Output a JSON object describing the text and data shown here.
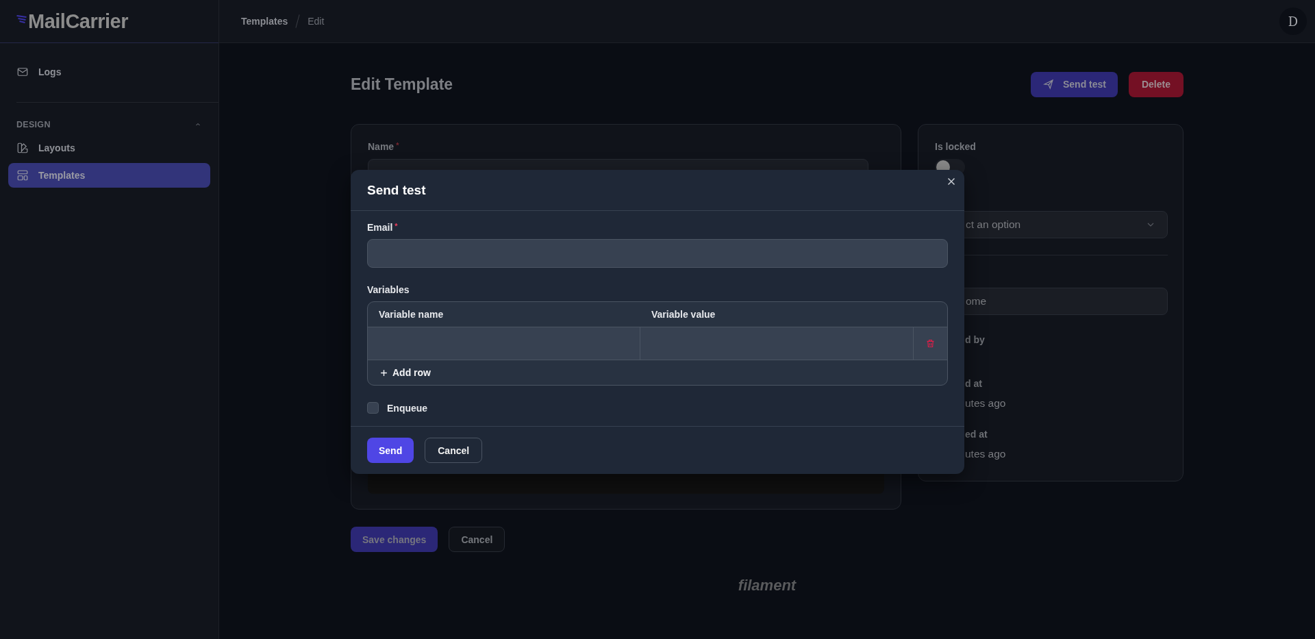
{
  "brand": {
    "name": "MailCarrier"
  },
  "breadcrumbs": [
    "Templates",
    "Edit"
  ],
  "user": {
    "initial": "D"
  },
  "sidebar": {
    "items": [
      {
        "label": "Logs",
        "selected": false
      }
    ],
    "groups": [
      {
        "label": "DESIGN",
        "expanded": true,
        "items": [
          {
            "label": "Layouts",
            "selected": false
          },
          {
            "label": "Templates",
            "selected": true
          }
        ]
      }
    ]
  },
  "page": {
    "title": "Edit Template",
    "actions": [
      {
        "label": "Send test",
        "kind": "primary"
      },
      {
        "label": "Delete",
        "kind": "danger"
      }
    ]
  },
  "form": {
    "name_label": "Name",
    "name_mark": "*"
  },
  "side_panel": {
    "locked_label": "Is locked",
    "locked": false,
    "select_text": "ct an option",
    "input_value": "ome",
    "fields": [
      {
        "label": "d by"
      },
      {
        "label": "d at",
        "value": "utes ago"
      },
      {
        "label": "ed at",
        "value": "utes ago"
      }
    ]
  },
  "form_actions": [
    {
      "label": "Save changes",
      "kind": "primary"
    },
    {
      "label": "Cancel",
      "kind": "secondary"
    }
  ],
  "footer": {
    "brand": "filament"
  },
  "modal": {
    "title": "Send test",
    "email_label": "Email",
    "email_mark": "*",
    "variables_label": "Variables",
    "columns": [
      "Variable name",
      "Variable value"
    ],
    "rows": [
      {
        "kind": "blank"
      }
    ],
    "add_row": "Add row",
    "enqueue": {
      "label": "Enqueue",
      "checked": false
    },
    "buttons": [
      {
        "label": "Send",
        "kind": "primary"
      },
      {
        "label": "Cancel",
        "kind": "secondary"
      }
    ]
  }
}
